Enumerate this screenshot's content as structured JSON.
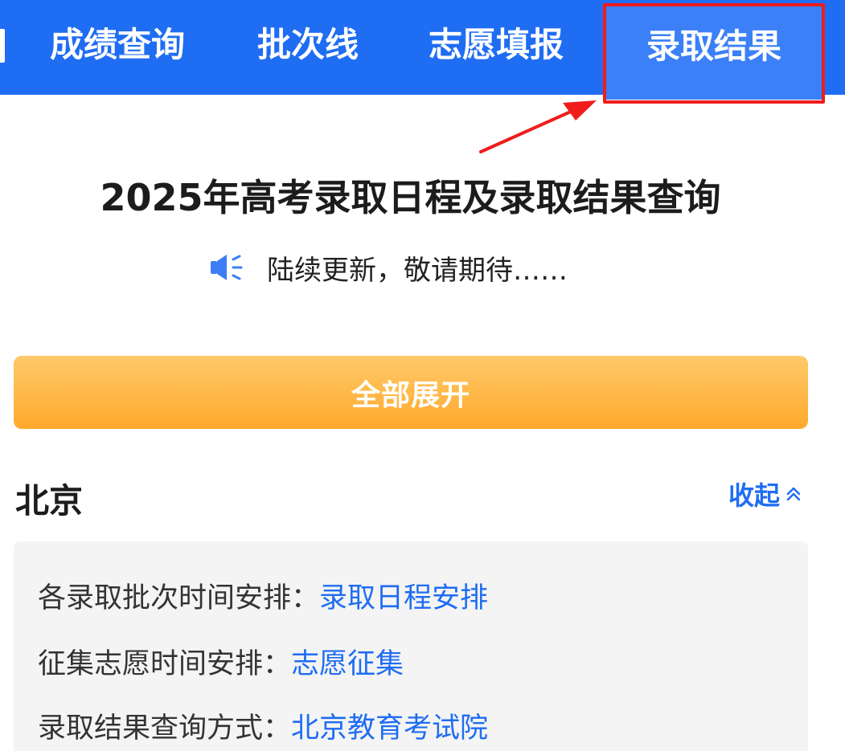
{
  "nav": {
    "tabs": [
      {
        "label": "成绩查询"
      },
      {
        "label": "批次线"
      },
      {
        "label": "志愿填报"
      },
      {
        "label": "录取结果",
        "active": true
      }
    ],
    "background_color": "#1f6df2",
    "active_tab_color": "#3b80f7",
    "highlight_color": "#f01c1c"
  },
  "header": {
    "title": "2025年高考录取日程及录取结果查询",
    "notice_icon": "speaker-icon",
    "notice_text": "陆续更新，敬请期待……"
  },
  "expand_button": {
    "label": "全部展开",
    "color": "#ffa92b"
  },
  "section": {
    "province": "北京",
    "collapse_label": "收起",
    "collapse_icon": "double-chevron-up-icon",
    "rows": [
      {
        "label": "各录取批次时间安排：",
        "link": "录取日程安排"
      },
      {
        "label": "征集志愿时间安排：",
        "link": "志愿征集"
      },
      {
        "label": "录取结果查询方式：",
        "link": "北京教育考试院"
      }
    ],
    "link_color": "#1f6df2"
  }
}
